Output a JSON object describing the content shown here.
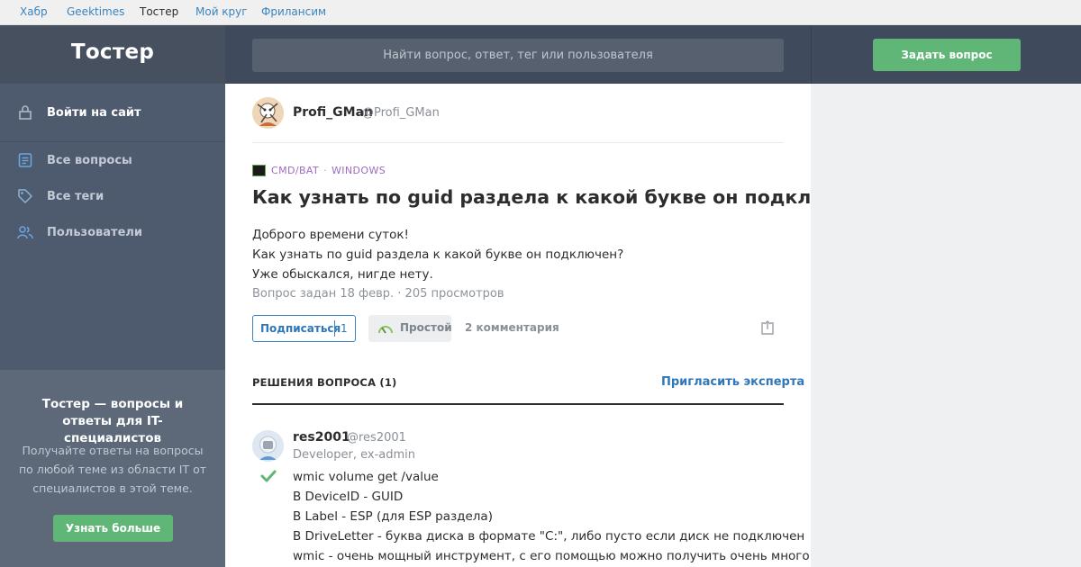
{
  "topnav": {
    "items": [
      "Хабр",
      "Geektimes",
      "Тостер",
      "Мой круг",
      "Фрилансим"
    ]
  },
  "header": {
    "logo": "Тостер",
    "search_placeholder": "Найти вопрос, ответ, тег или пользователя",
    "ask_button": "Задать вопрос"
  },
  "sidebar": {
    "login": "Войти на сайт",
    "items": [
      {
        "label": "Все вопросы",
        "icon": "questions-icon"
      },
      {
        "label": "Все теги",
        "icon": "tag-icon"
      },
      {
        "label": "Пользователи",
        "icon": "users-icon"
      }
    ],
    "promo": {
      "title": "Тостер — вопросы и ответы для IT-специалистов",
      "text": "Получайте ответы на вопросы по любой теме из области IT от специалистов в этой теме.",
      "button": "Узнать больше"
    }
  },
  "question": {
    "author_name": "Profi_GMan",
    "author_nick": "@Profi_GMan",
    "tags": [
      "CMD/BAT",
      "WINDOWS"
    ],
    "title": "Как узнать по guid раздела к какой букве он подключен?",
    "body": [
      "Доброго времени суток!",
      "Как узнать по guid раздела к какой букве он подключен?",
      "Уже обыскался, нигде нету."
    ],
    "meta": "Вопрос задан 18 февр. · 205 просмотров",
    "subscribe_label": "Подписаться",
    "subscribe_count": "1",
    "difficulty": "Простой",
    "comments": "2 комментария"
  },
  "solutions": {
    "header": "РЕШЕНИЯ ВОПРОСА (1)",
    "invite": "Пригласить эксперта",
    "answer": {
      "author_name": "res2001",
      "author_nick": "@res2001",
      "author_role": "Developer, ex-admin",
      "body": [
        "wmic volume get /value",
        "В DeviceID - GUID",
        "В Label - ESP (для ESP раздела)",
        "В DriveLetter - буква диска в формате \"C:\", либо пусто если диск не подключен",
        "wmic - очень мощный инструмент, с его помощью можно получить очень много"
      ]
    }
  },
  "colors": {
    "accent_green": "#5fb677",
    "link_blue": "#2f77b8",
    "tag_purple": "#9f6ac2",
    "header_bg": "#3f4a5c"
  }
}
